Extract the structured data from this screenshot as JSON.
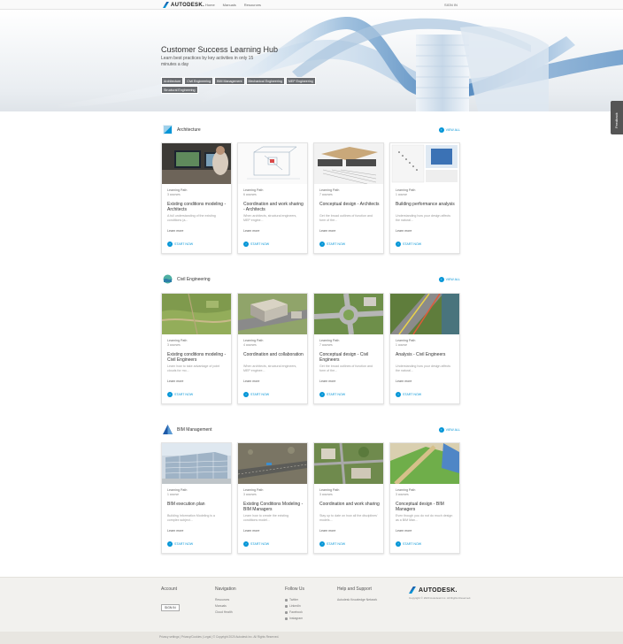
{
  "header": {
    "brand": "AUTODESK.",
    "nav": [
      "Home",
      "Manuals",
      "Resources"
    ],
    "signin": "SIGN IN"
  },
  "hero": {
    "title": "Customer Success Learning Hub",
    "subtitle": "Learn best practices by key activities in only 15 minutes a day",
    "tags": [
      "Architecture",
      "Civil Engineering",
      "BIM Management",
      "Mechanical Engineering",
      "MEP Engineering",
      "Structural Engineering"
    ]
  },
  "feedback_label": "Feedback",
  "view_all_label": "VIEW ALL",
  "learn_more_label": "Learn more",
  "start_now_label": "START NOW",
  "sections": [
    {
      "title": "Architecture",
      "cards": [
        {
          "type": "Learning Path",
          "count": "3 courses",
          "title": "Existing conditions modeling - Architects",
          "desc": "A full understanding of the existing conditions (a...",
          "image": "office-computer-photo"
        },
        {
          "type": "Learning Path",
          "count": "6 courses",
          "title": "Coordination and work sharing - Architects",
          "desc": "When architects, structural engineers, MEP engine...",
          "image": "wireframe-model"
        },
        {
          "type": "Learning Path",
          "count": "7 courses",
          "title": "Conceptual design - Architects",
          "desc": "Get the broad outlines of function and form of the...",
          "image": "conceptual-mass-diagram"
        },
        {
          "type": "Learning Path",
          "count": "1 course",
          "title": "Building performance analysis",
          "desc": "Understanding how your design affects the natural...",
          "image": "analysis-charts"
        }
      ]
    },
    {
      "title": "Civil Engineering",
      "cards": [
        {
          "type": "Learning Path",
          "count": "3 courses",
          "title": "Existing conditions modeling - Civil Engineers",
          "desc": "Learn how to take advantage of point clouds for mo...",
          "image": "aerial-terrain"
        },
        {
          "type": "Learning Path",
          "count": "4 courses",
          "title": "Coordination and collaboration",
          "desc": "When architects, structural engineers, MEP enginee...",
          "image": "site-building-render"
        },
        {
          "type": "Learning Path",
          "count": "7 courses",
          "title": "Conceptual design - Civil Engineers",
          "desc": "Get the broad outlines of function and form of the...",
          "image": "roundabout-render"
        },
        {
          "type": "Learning Path",
          "count": "1 course",
          "title": "Analysis - Civil Engineers",
          "desc": "Understanding how your design affects the natural...",
          "image": "road-analysis"
        }
      ]
    },
    {
      "title": "BIM Management",
      "cards": [
        {
          "type": "Learning Path",
          "count": "1 course",
          "title": "BIM execution plan",
          "desc": "Building Information Modeling is a complex subject...",
          "image": "glass-office-building"
        },
        {
          "type": "Learning Path",
          "count": "3 courses",
          "title": "Existing Conditions Modeling - BIM Managers",
          "desc": "Learn how to create the existing conditions model...",
          "image": "point-cloud-road"
        },
        {
          "type": "Learning Path",
          "count": "3 courses",
          "title": "Coordination and work sharing",
          "desc": "Stay up to date on how all the disciplines' models...",
          "image": "aerial-campus"
        },
        {
          "type": "Learning Path",
          "count": "3 courses",
          "title": "Conceptual design - BIM Managers",
          "desc": "Even though you do not do much design as a BIM Man...",
          "image": "terrain-model"
        }
      ]
    }
  ],
  "footer": {
    "account": {
      "heading": "Account",
      "button": "SIGN IN"
    },
    "navigation": {
      "heading": "Navigation",
      "items": [
        "Resources",
        "Manuals",
        "Cloud Health"
      ]
    },
    "follow": {
      "heading": "Follow Us",
      "items": [
        "Twitter",
        "LinkedIn",
        "Facebook",
        "Instagram"
      ]
    },
    "help": {
      "heading": "Help and Support",
      "items": [
        "Autodesk Knowledge Network"
      ]
    },
    "brand": "AUTODESK.",
    "copyright": "Copyright © 2020 Autodesk Inc. All Rights Reserved.",
    "legal": "Privacy settings | Privacy/Cookies | Legal | © Copyright 2020 Autodesk Inc. All Rights Reserved."
  },
  "colors": {
    "accent": "#0696d7",
    "tag_bg": "#6b6e72",
    "footer_bg": "#f2f1ee"
  }
}
